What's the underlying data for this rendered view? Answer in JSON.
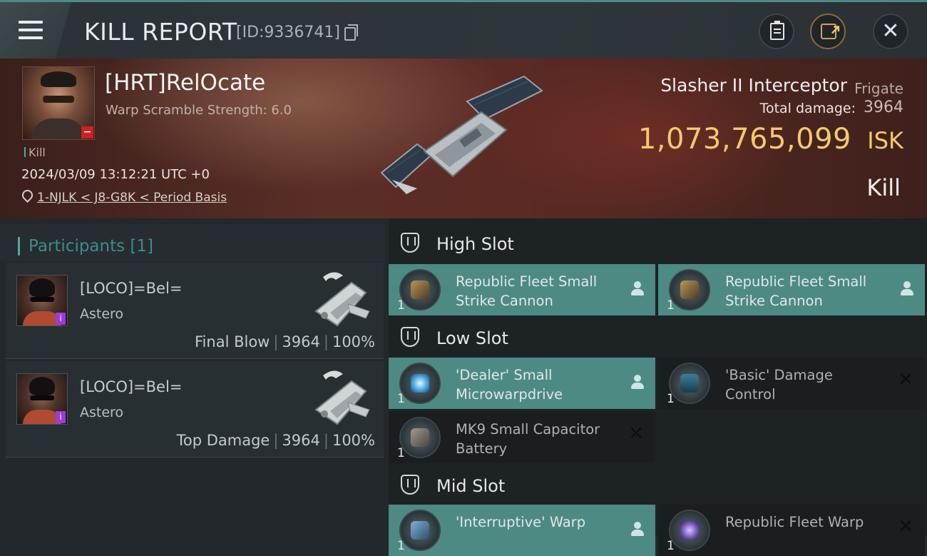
{
  "header": {
    "title": "KILL REPORT",
    "kill_id": "[ID:9336741]"
  },
  "victim": {
    "name": "[HRT]RelOcate",
    "scramble": "Warp Scramble Strength: 6.0",
    "tag": "Kill",
    "datetime": "2024/03/09 13:12:21 UTC +0",
    "location": "1-NJLK < J8-G8K < Period Basis",
    "ship_name": "Slasher II Interceptor",
    "ship_class": "Frigate",
    "total_damage_label": "Total damage:",
    "total_damage": "3964",
    "isk_value": "1,073,765,099",
    "isk_unit": "ISK",
    "result": "Kill"
  },
  "participants": {
    "title": "Participants [1]",
    "items": [
      {
        "name": "[LOCO]=Bel=",
        "ship": "Astero",
        "role": "Final Blow",
        "damage": "3964",
        "percent": "100%"
      },
      {
        "name": "[LOCO]=Bel=",
        "ship": "Astero",
        "role": "Top Damage",
        "damage": "3964",
        "percent": "100%"
      }
    ]
  },
  "fitting": {
    "high": {
      "title": "High Slot",
      "modules": [
        {
          "qty": "1",
          "name": "Republic Fleet Small Strike Cannon",
          "state": "dropped"
        },
        {
          "qty": "1",
          "name": "Republic Fleet Small Strike Cannon",
          "state": "dropped"
        }
      ]
    },
    "low": {
      "title": "Low Slot",
      "modules": [
        {
          "qty": "1",
          "name": "'Dealer' Small Microwarpdrive",
          "state": "dropped"
        },
        {
          "qty": "1",
          "name": "'Basic' Damage Control",
          "state": "destroyed"
        },
        {
          "qty": "1",
          "name": "MK9 Small Capacitor Battery",
          "state": "destroyed"
        }
      ]
    },
    "mid": {
      "title": "Mid Slot",
      "modules": [
        {
          "qty": "1",
          "name": "'Interruptive' Warp",
          "state": "dropped"
        },
        {
          "qty": "1",
          "name": "Republic Fleet Warp",
          "state": "destroyed"
        }
      ]
    }
  },
  "colors": {
    "accent": "#4aa8a2",
    "isk": "#f4c96e",
    "dropped_module": "#4d8a83",
    "destroyed_module": "#1a1e20"
  },
  "icons": {
    "menu": "hamburger-icon",
    "copy": "copy-icon",
    "clipboard": "clipboard-icon",
    "share": "share-icon",
    "close": "close-icon",
    "location": "location-pin-icon",
    "slot": "shield-slot-icon",
    "pilot": "pilot-icon",
    "destroyed": "x-icon"
  }
}
